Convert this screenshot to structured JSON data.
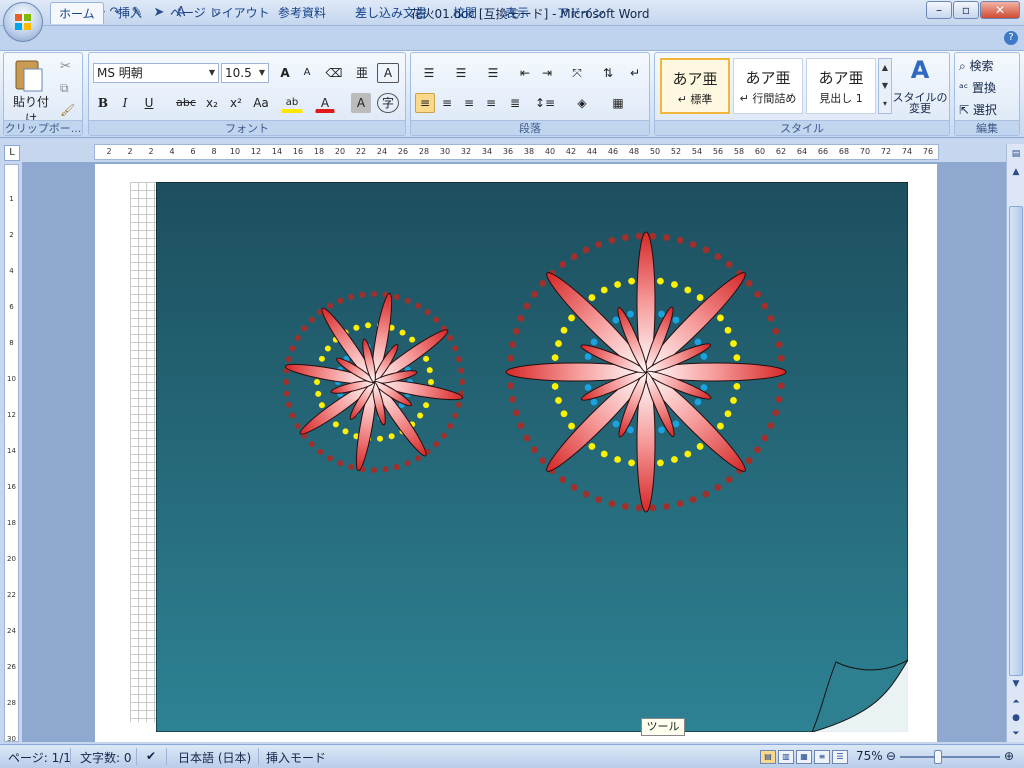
{
  "window": {
    "title": "花火01.doc [互換モード] - Microsoft Word"
  },
  "quick_access": {
    "save_icon": "save-icon",
    "undo_icon": "undo-icon",
    "redo_icon": "redo-icon",
    "more": "▿"
  },
  "tabs": [
    "ホーム",
    "挿入",
    "ページ レイアウト",
    "参考資料",
    "差し込み文書",
    "校閲",
    "表示",
    "アドイン"
  ],
  "ribbon": {
    "clipboard": {
      "paste": "貼り付け",
      "label": "クリップボー..."
    },
    "font": {
      "name": "MS 明朝",
      "size": "10.5",
      "label": "フォント",
      "grow": "A",
      "shrink": "A",
      "bold": "B",
      "italic": "I",
      "underline": "U",
      "strike": "abc",
      "sub": "x₂",
      "sup": "x²",
      "case": "Aa",
      "highlight": "ab",
      "color": "A",
      "shading": "A",
      "enclose": "字"
    },
    "paragraph": {
      "label": "段落"
    },
    "styles": {
      "label": "スタイル",
      "items": [
        {
          "sample": "あア亜",
          "name": "↵ 標準"
        },
        {
          "sample": "あア亜",
          "name": "↵ 行間詰め"
        },
        {
          "sample": "あア亜",
          "name": "見出し 1"
        }
      ],
      "change": "スタイルの\n変更"
    },
    "editing": {
      "label": "編集",
      "find": "検索",
      "replace": "置換",
      "select": "選択"
    }
  },
  "ruler_h": [
    "2",
    "2",
    "2",
    "4",
    "6",
    "8",
    "10",
    "12",
    "14",
    "16",
    "18",
    "20",
    "22",
    "24",
    "26",
    "28",
    "30",
    "32",
    "34",
    "36",
    "38",
    "40",
    "42",
    "44",
    "46",
    "48",
    "50",
    "52",
    "54",
    "56",
    "58",
    "60",
    "62",
    "64",
    "66",
    "68",
    "70",
    "72",
    "74",
    "76"
  ],
  "ruler_v": [
    "1",
    "2",
    "4",
    "6",
    "8",
    "10",
    "12",
    "14",
    "16",
    "18",
    "20",
    "22",
    "24",
    "26",
    "28",
    "30"
  ],
  "tooltip": "ツール",
  "status": {
    "page": "ページ: 1/1",
    "words": "文字数: 0",
    "language": "日本語 (日本)",
    "mode": "挿入モード",
    "zoom": "75%"
  },
  "colors": {
    "bg_top": "#1d4f5e",
    "bg_bottom": "#2c7f90",
    "outer_ring": "#a0302c",
    "mid_ring": "#fff200",
    "inner_ring": "#1aa3e0",
    "petal": "#e84a4a"
  }
}
